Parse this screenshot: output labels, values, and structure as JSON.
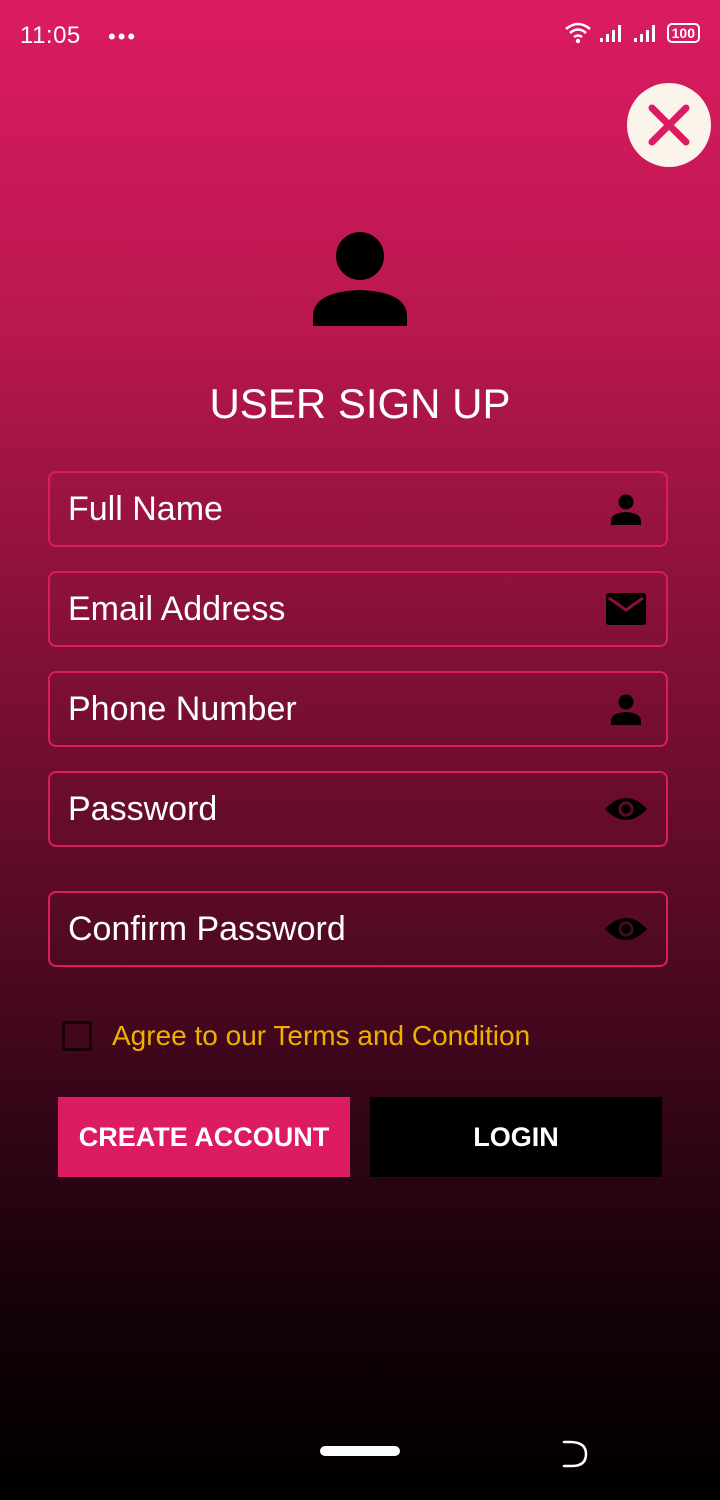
{
  "status_bar": {
    "time": "11:05",
    "dots": "•••",
    "battery": "100"
  },
  "header": {
    "title": "USER SIGN UP"
  },
  "form": {
    "fields": [
      {
        "placeholder": "Full Name",
        "icon": "person-icon"
      },
      {
        "placeholder": "Email Address",
        "icon": "mail-icon"
      },
      {
        "placeholder": "Phone Number",
        "icon": "person-icon"
      },
      {
        "placeholder": "Password",
        "icon": "eye-icon"
      },
      {
        "placeholder": "Confirm Password",
        "icon": "eye-icon"
      }
    ],
    "terms_label": "Agree to our Terms and Condition",
    "terms_checked": false
  },
  "actions": {
    "create_label": "CREATE ACCOUNT",
    "login_label": "LOGIN"
  },
  "colors": {
    "accent": "#dc1b62",
    "terms_text": "#f0b000",
    "close_bg": "#fbf4ea"
  }
}
